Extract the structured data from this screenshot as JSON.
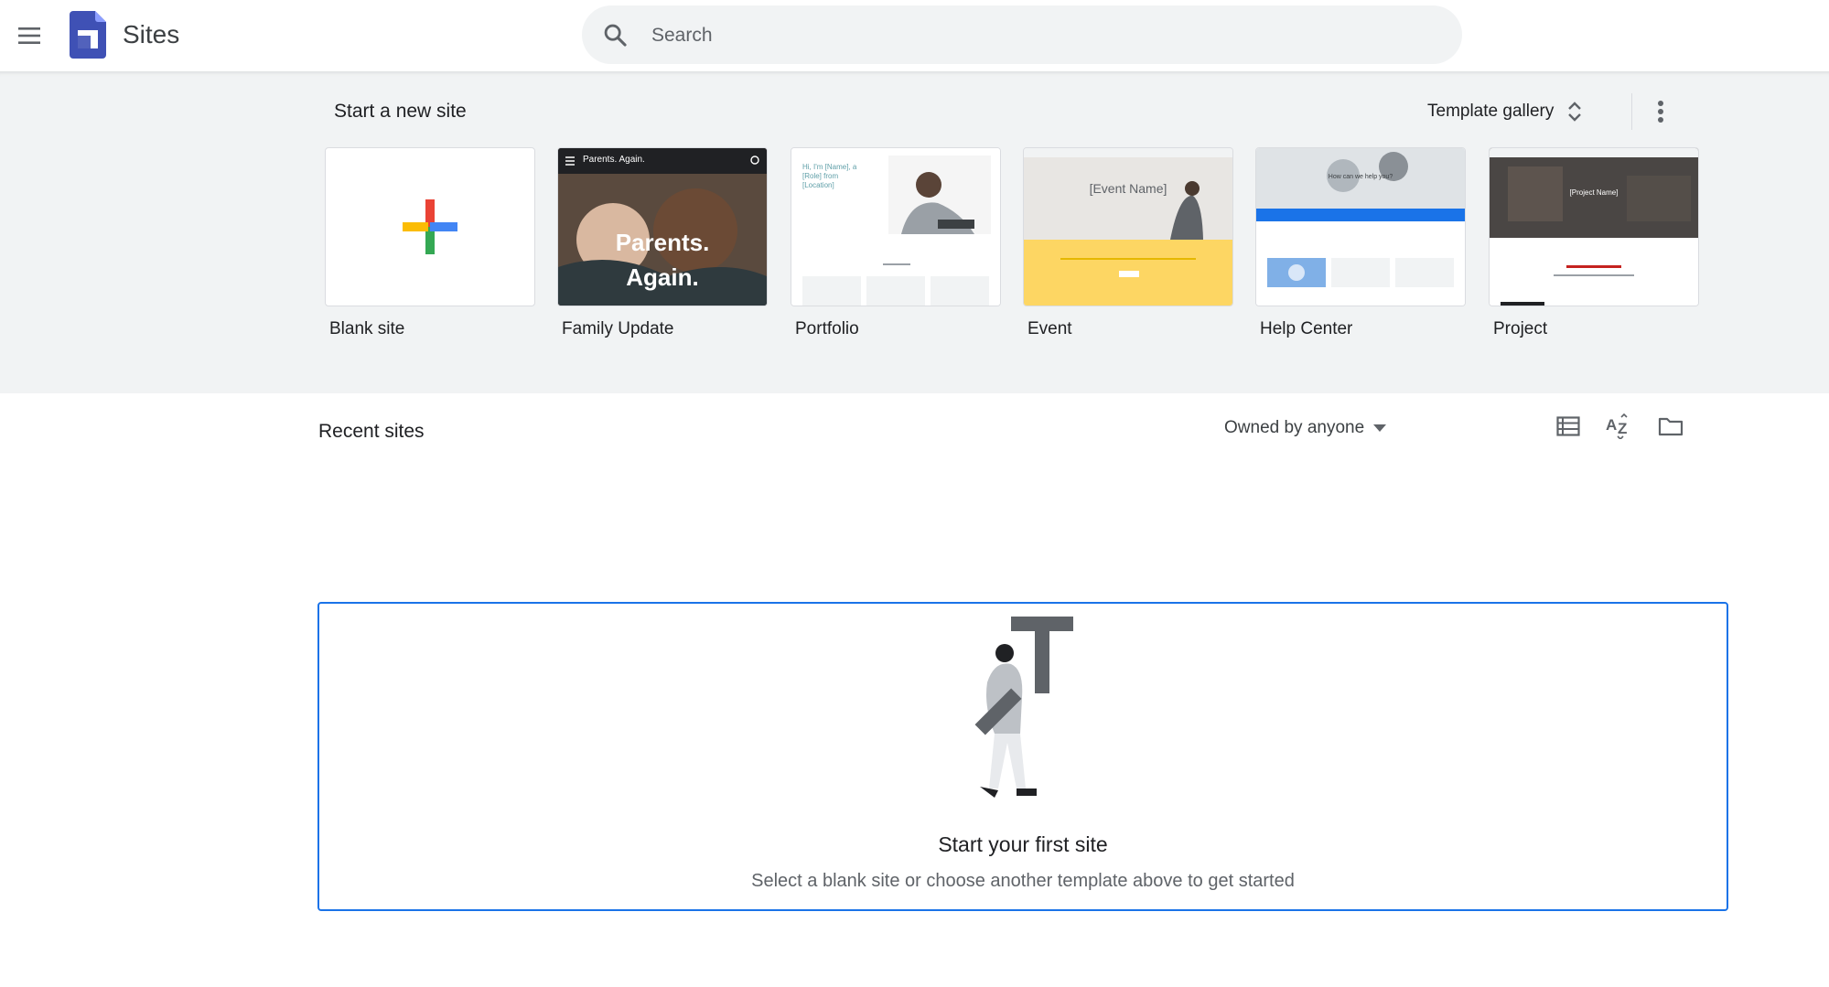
{
  "app": {
    "title": "Sites"
  },
  "search": {
    "placeholder": "Search"
  },
  "templates": {
    "section_title": "Start a new site",
    "gallery_label": "Template gallery",
    "items": [
      {
        "label": "Blank site"
      },
      {
        "label": "Family Update",
        "thumb_heading": "Parents. Again.",
        "thumb_text_1": "Parents.",
        "thumb_text_2": "Again."
      },
      {
        "label": "Portfolio",
        "thumb_text": "Hi, I'm [Name], a [Role] from [Location]"
      },
      {
        "label": "Event",
        "thumb_text": "[Event Name]"
      },
      {
        "label": "Help Center",
        "thumb_text": "How can we help you?"
      },
      {
        "label": "Project",
        "thumb_text": "[Project Name]"
      }
    ]
  },
  "recent": {
    "title": "Recent sites",
    "owner_filter": "Owned by anyone",
    "empty_title": "Start your first site",
    "empty_subtitle": "Select a blank site or choose another template above to get started"
  },
  "colors": {
    "accent": "#1a73e8",
    "sites_logo": "#3f51b5",
    "plus_red": "#ea4335",
    "plus_yellow": "#fbbc04",
    "plus_green": "#34a853",
    "plus_blue": "#4285f4",
    "event_yellow": "#fdd663"
  },
  "icons": {
    "menu": "hamburger-menu-icon",
    "search": "search-icon",
    "gallery": "unfold-more-icon",
    "more": "more-vert-icon",
    "list_view": "list-view-icon",
    "sort": "sort-az-icon",
    "folder": "folder-icon",
    "dropdown": "arrow-drop-down-icon"
  }
}
